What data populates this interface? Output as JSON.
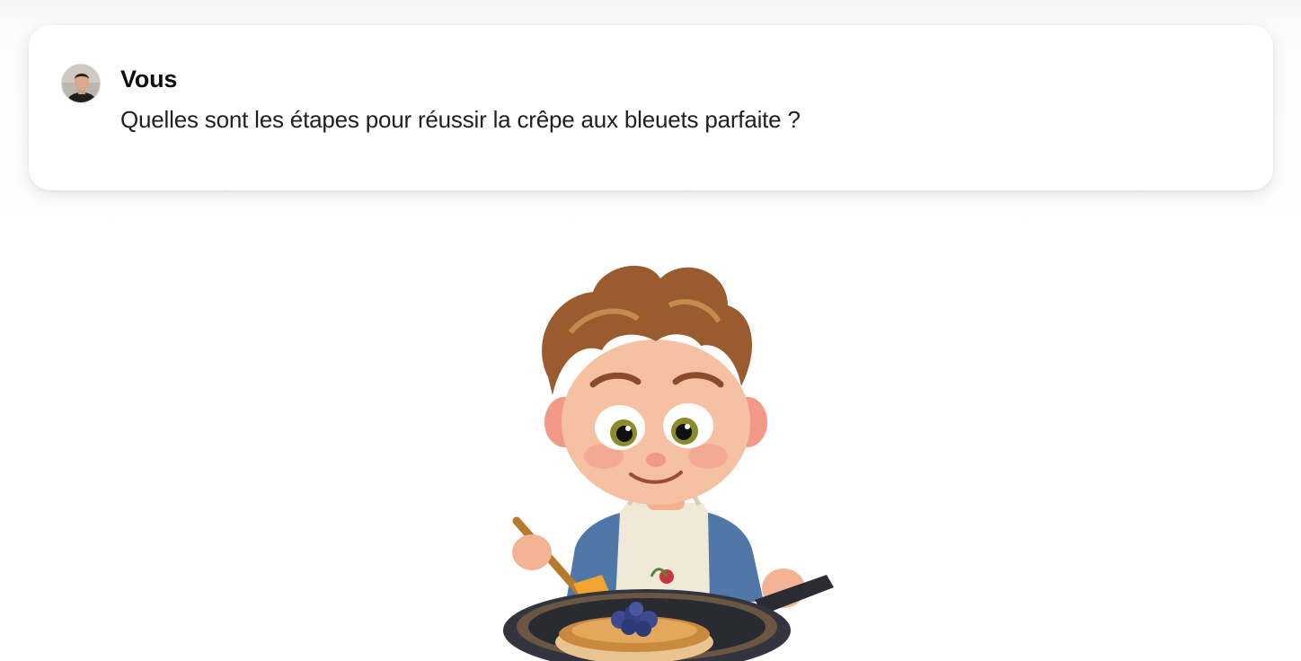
{
  "message": {
    "author": "Vous",
    "text": "Quelles sont les étapes pour réussir la crêpe aux bleuets parfaite ?",
    "avatar_icon": "user-avatar-photo"
  },
  "illustration": {
    "icon": "boy-cooking-blueberry-pancake-illustration"
  },
  "colors": {
    "card_background": "#ffffff",
    "page_background": "#ffffff",
    "text_primary": "#0d0d0d"
  }
}
